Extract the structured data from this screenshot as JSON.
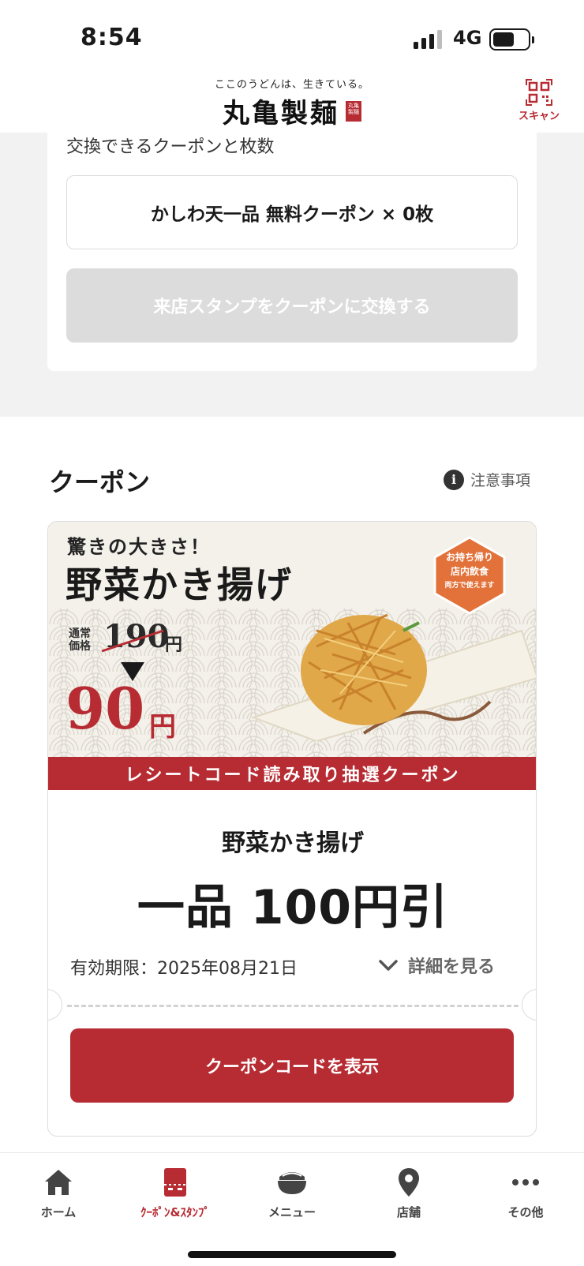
{
  "status_bar": {
    "time": "8:54",
    "network": "4G",
    "battery_percent": 50
  },
  "header": {
    "tagline": "ここのうどんは、生きている。",
    "logo": "丸亀製麺",
    "scan_label": "スキャン"
  },
  "stamp_card": {
    "caption": "交換できるクーポンと枚数",
    "coupon_count_text": "かしわ天一品 無料クーポン × 0枚",
    "exchange_button": "来店スタンプをクーポンに交換する"
  },
  "coupon_section": {
    "title": "クーポン",
    "notice_label": "注意事項",
    "coupon": {
      "banner": {
        "catchphrase": "驚きの大きさ！",
        "product": "野菜かき揚げ",
        "regular_label": "通常価格",
        "regular_price": "190",
        "sale_price": "90",
        "yen": "円",
        "badge_line1": "お持ち帰り",
        "badge_line2": "店内飲食",
        "badge_line3": "両方で使えます",
        "strip": "レシートコード読み取り抽選クーポン"
      },
      "name": "野菜かき揚げ",
      "discount": "一品 100円引",
      "expiry": "有効期限：2025年08月21日",
      "details_label": "詳細を見る",
      "code_button": "クーポンコードを表示"
    }
  },
  "tabbar": {
    "items": [
      {
        "label": "ホーム",
        "icon": "home-icon"
      },
      {
        "label": "ｸｰﾎﾟﾝ&ｽﾀﾝﾌﾟ",
        "icon": "coupon-icon",
        "active": true
      },
      {
        "label": "メニュー",
        "icon": "bowl-icon"
      },
      {
        "label": "店舗",
        "icon": "location-pin-icon"
      },
      {
        "label": "その他",
        "icon": "more-icon"
      }
    ]
  },
  "colors": {
    "accent": "#b72c33",
    "disabled": "#dcdcdc",
    "background": "#f2f2f2"
  }
}
